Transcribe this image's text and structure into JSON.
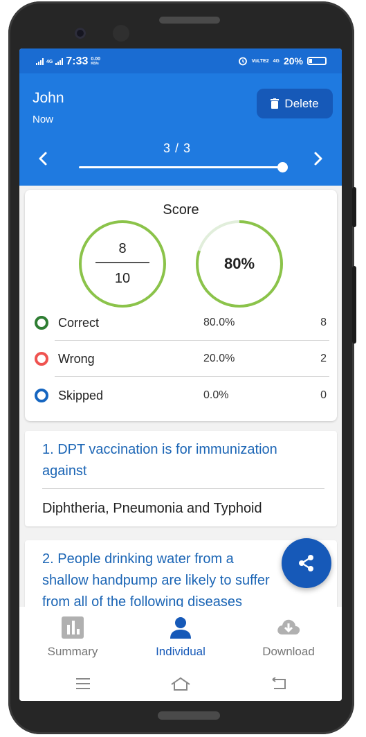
{
  "status_bar": {
    "time": "7:33",
    "network_left": "4G",
    "speed": "0.00",
    "speed_unit": "KB/s",
    "volte": "VoLTE2",
    "network_right": "4G",
    "battery": "20%"
  },
  "header": {
    "name": "John",
    "time": "Now",
    "delete_label": "Delete",
    "pager": "3 / 3",
    "pager_progress": 1.0
  },
  "score": {
    "title": "Score",
    "numerator": "8",
    "denominator": "10",
    "percent": "80%",
    "percent_value": 0.8,
    "ring_color": "#8bc34a",
    "rows": [
      {
        "label": "Correct",
        "pct": "80.0%",
        "count": "8",
        "color": "#2e7d32"
      },
      {
        "label": "Wrong",
        "pct": "20.0%",
        "count": "2",
        "color": "#ef5350"
      },
      {
        "label": "Skipped",
        "pct": "0.0%",
        "count": "0",
        "color": "#1565c0"
      }
    ]
  },
  "questions": [
    {
      "text_line1": "1. DPT vaccination is for immunization",
      "text_line2": "against",
      "answer": "Diphtheria, Pneumonia and Typhoid"
    },
    {
      "text_line1": "2. People drinking water from a",
      "text_line2": "shallow handpump are likely to suffer",
      "text_line3": "from all of the following diseases"
    }
  ],
  "bottom_nav": {
    "summary": "Summary",
    "individual": "Individual",
    "download": "Download"
  },
  "colors": {
    "primary": "#1f7ae0",
    "primary_dark": "#1659b8",
    "status_bar": "#1a6cd2",
    "question_text": "#1b65b5"
  }
}
